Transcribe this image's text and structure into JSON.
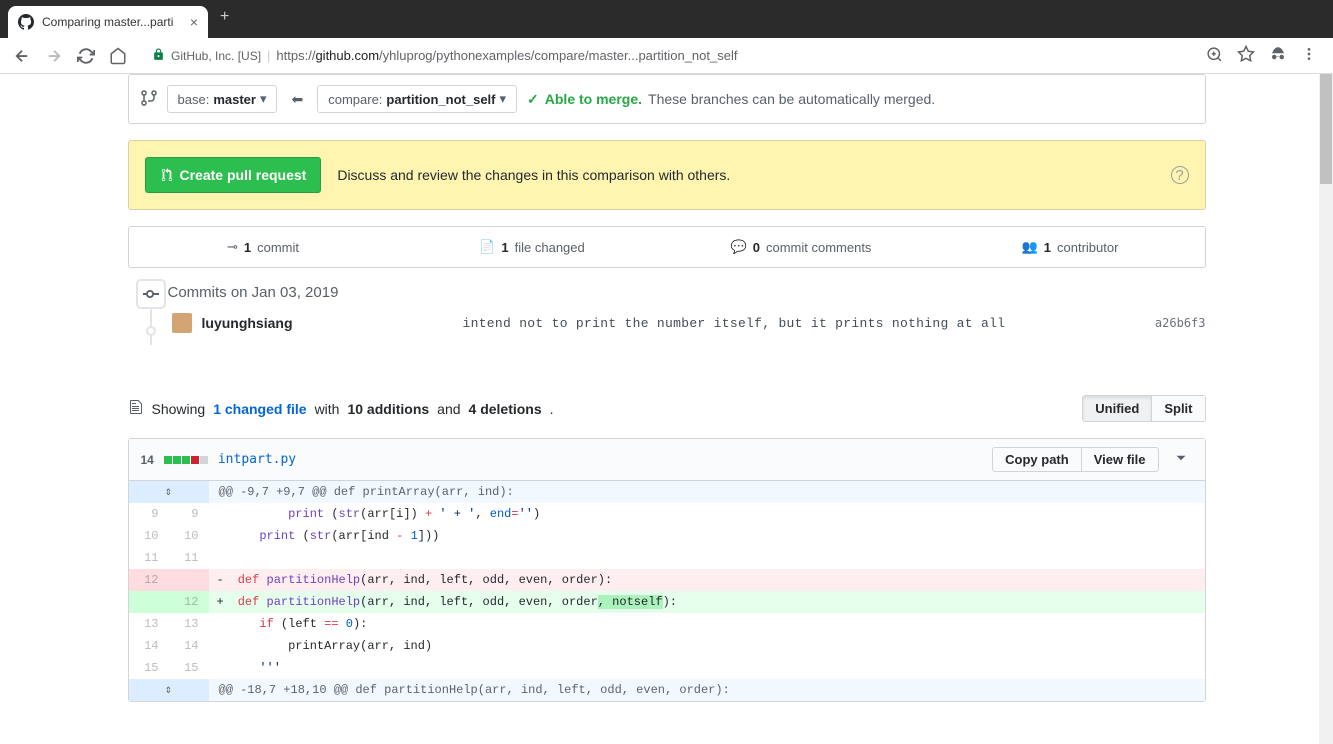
{
  "browser": {
    "tab_title": "Comparing master...parti",
    "url_prefix": "GitHub, Inc. [US]",
    "url_proto": "https://",
    "url_host": "github.com",
    "url_path": "/yhluprog/pythonexamples/compare/master...partition_not_self"
  },
  "compare": {
    "base_label": "base:",
    "base_branch": "master",
    "compare_label": "compare:",
    "compare_branch": "partition_not_self",
    "able_to_merge": "Able to merge.",
    "merge_detail": "These branches can be automatically merged."
  },
  "pr": {
    "button": "Create pull request",
    "desc": "Discuss and review the changes in this comparison with others."
  },
  "stats": {
    "commits_n": "1",
    "commits_t": "commit",
    "files_n": "1",
    "files_t": "file changed",
    "comments_n": "0",
    "comments_t": "commit comments",
    "contrib_n": "1",
    "contrib_t": "contributor"
  },
  "timeline": {
    "date": "Commits on Jan 03, 2019",
    "author": "luyunghsiang",
    "msg": "intend not to print the number itself, but it prints nothing at all",
    "sha": "a26b6f3"
  },
  "summary": {
    "showing": "Showing",
    "changed": "1 changed file",
    "with": "with",
    "additions": "10 additions",
    "and": "and",
    "deletions": "4 deletions",
    "unified": "Unified",
    "split": "Split"
  },
  "file": {
    "count": "14",
    "name": "intpart.py",
    "copy": "Copy path",
    "view": "View file"
  },
  "diff": {
    "hunk1": "@@ -9,7 +9,7 @@ def printArray(arr, ind):",
    "hunk2": "@@ -18,7 +18,10 @@ def partitionHelp(arr, ind, left, odd, even, order):",
    "rows": [
      {
        "l": "9",
        "r": "9",
        "type": "ctx",
        "html": "        <span class='fn'>print</span> (<span class='fn'>str</span>(arr[i]) <span class='op'>+</span> <span class='str'>' + '</span>, <span class='num'>end</span><span class='op'>=</span><span class='str'>''</span>)"
      },
      {
        "l": "10",
        "r": "10",
        "type": "ctx",
        "html": "    <span class='fn'>print</span> (<span class='fn'>str</span>(arr[ind <span class='op'>-</span> <span class='num'>1</span>]))"
      },
      {
        "l": "11",
        "r": "11",
        "type": "ctx",
        "html": ""
      },
      {
        "l": "12",
        "r": "",
        "type": "del",
        "html": " <span class='kw'>def</span> <span class='fn'>partitionHelp</span>(arr, ind, left, odd, even, order):"
      },
      {
        "l": "",
        "r": "12",
        "type": "add",
        "html": " <span class='kw'>def</span> <span class='fn'>partitionHelp</span>(arr, ind, left, odd, even, order<span class='add-highlight'>, notself</span>):"
      },
      {
        "l": "13",
        "r": "13",
        "type": "ctx",
        "html": "    <span class='kw'>if</span> (left <span class='op'>==</span> <span class='num'>0</span>):"
      },
      {
        "l": "14",
        "r": "14",
        "type": "ctx",
        "html": "        printArray(arr, ind)"
      },
      {
        "l": "15",
        "r": "15",
        "type": "ctx",
        "html": "    <span class='str'>'''</span>"
      }
    ]
  }
}
